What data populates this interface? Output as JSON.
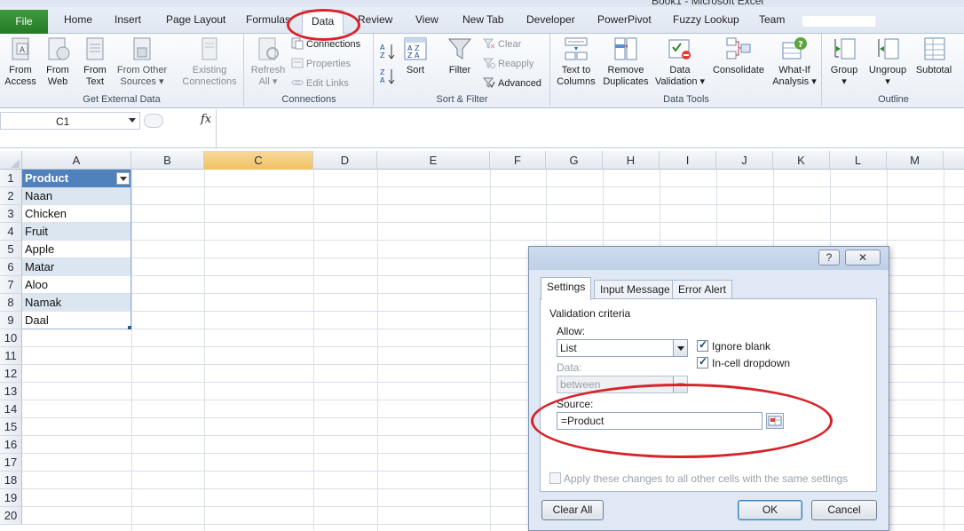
{
  "window": {
    "title": "Book1 - Microsoft Excel"
  },
  "ribbon_tabs": [
    {
      "label": "File"
    },
    {
      "label": "Home"
    },
    {
      "label": "Insert"
    },
    {
      "label": "Page Layout"
    },
    {
      "label": "Formulas"
    },
    {
      "label": "Data"
    },
    {
      "label": "Review"
    },
    {
      "label": "View"
    },
    {
      "label": "New Tab"
    },
    {
      "label": "Developer"
    },
    {
      "label": "PowerPivot"
    },
    {
      "label": "Fuzzy Lookup"
    },
    {
      "label": "Team"
    }
  ],
  "active_tab": "Data",
  "ribbon": {
    "get_external": {
      "label": "Get External Data",
      "from_access": "From\nAccess",
      "from_web": "From\nWeb",
      "from_text": "From\nText",
      "from_other": "From Other\nSources ▾",
      "existing": "Existing\nConnections"
    },
    "connections": {
      "label": "Connections",
      "refresh_all": "Refresh\nAll ▾",
      "connections": "Connections",
      "properties": "Properties",
      "edit_links": "Edit Links"
    },
    "sort_filter": {
      "label": "Sort & Filter",
      "sort": "Sort",
      "filter": "Filter",
      "clear": "Clear",
      "reapply": "Reapply",
      "advanced": "Advanced"
    },
    "data_tools": {
      "label": "Data Tools",
      "text_to_columns": "Text to\nColumns",
      "remove_duplicates": "Remove\nDuplicates",
      "data_validation": "Data\nValidation ▾",
      "consolidate": "Consolidate",
      "what_if": "What-If\nAnalysis ▾"
    },
    "outline": {
      "label": "Outline",
      "group": "Group\n▾",
      "ungroup": "Ungroup\n▾",
      "subtotal": "Subtotal"
    }
  },
  "formula_bar": {
    "name_box": "C1",
    "fx": "fx",
    "formula": ""
  },
  "columns": [
    "A",
    "B",
    "C",
    "D",
    "E",
    "F",
    "G",
    "H",
    "I",
    "J",
    "K",
    "L",
    "M"
  ],
  "rows": [
    "1",
    "2",
    "3",
    "4",
    "5",
    "6",
    "7",
    "8",
    "9",
    "10",
    "11",
    "12",
    "13",
    "14",
    "15",
    "16",
    "17",
    "18",
    "19",
    "20"
  ],
  "table": {
    "header": "Product",
    "items": [
      "Naan",
      "Chicken",
      "Fruit",
      "Apple",
      "Matar",
      "Aloo",
      "Namak",
      "Daal"
    ]
  },
  "dialog": {
    "help": "?",
    "close": "✕",
    "tabs": [
      "Settings",
      "Input Message",
      "Error Alert"
    ],
    "section": "Validation criteria",
    "allow_label": "Allow:",
    "allow_value": "List",
    "ignore_blank": "Ignore blank",
    "in_cell_dropdown": "In-cell dropdown",
    "data_label": "Data:",
    "data_value": "between",
    "source_label": "Source:",
    "source_value": "=Product",
    "apply_all": "Apply these changes to all other cells with the same settings",
    "clear_all": "Clear All",
    "ok": "OK",
    "cancel": "Cancel"
  },
  "annotation_color": "#d9222a"
}
